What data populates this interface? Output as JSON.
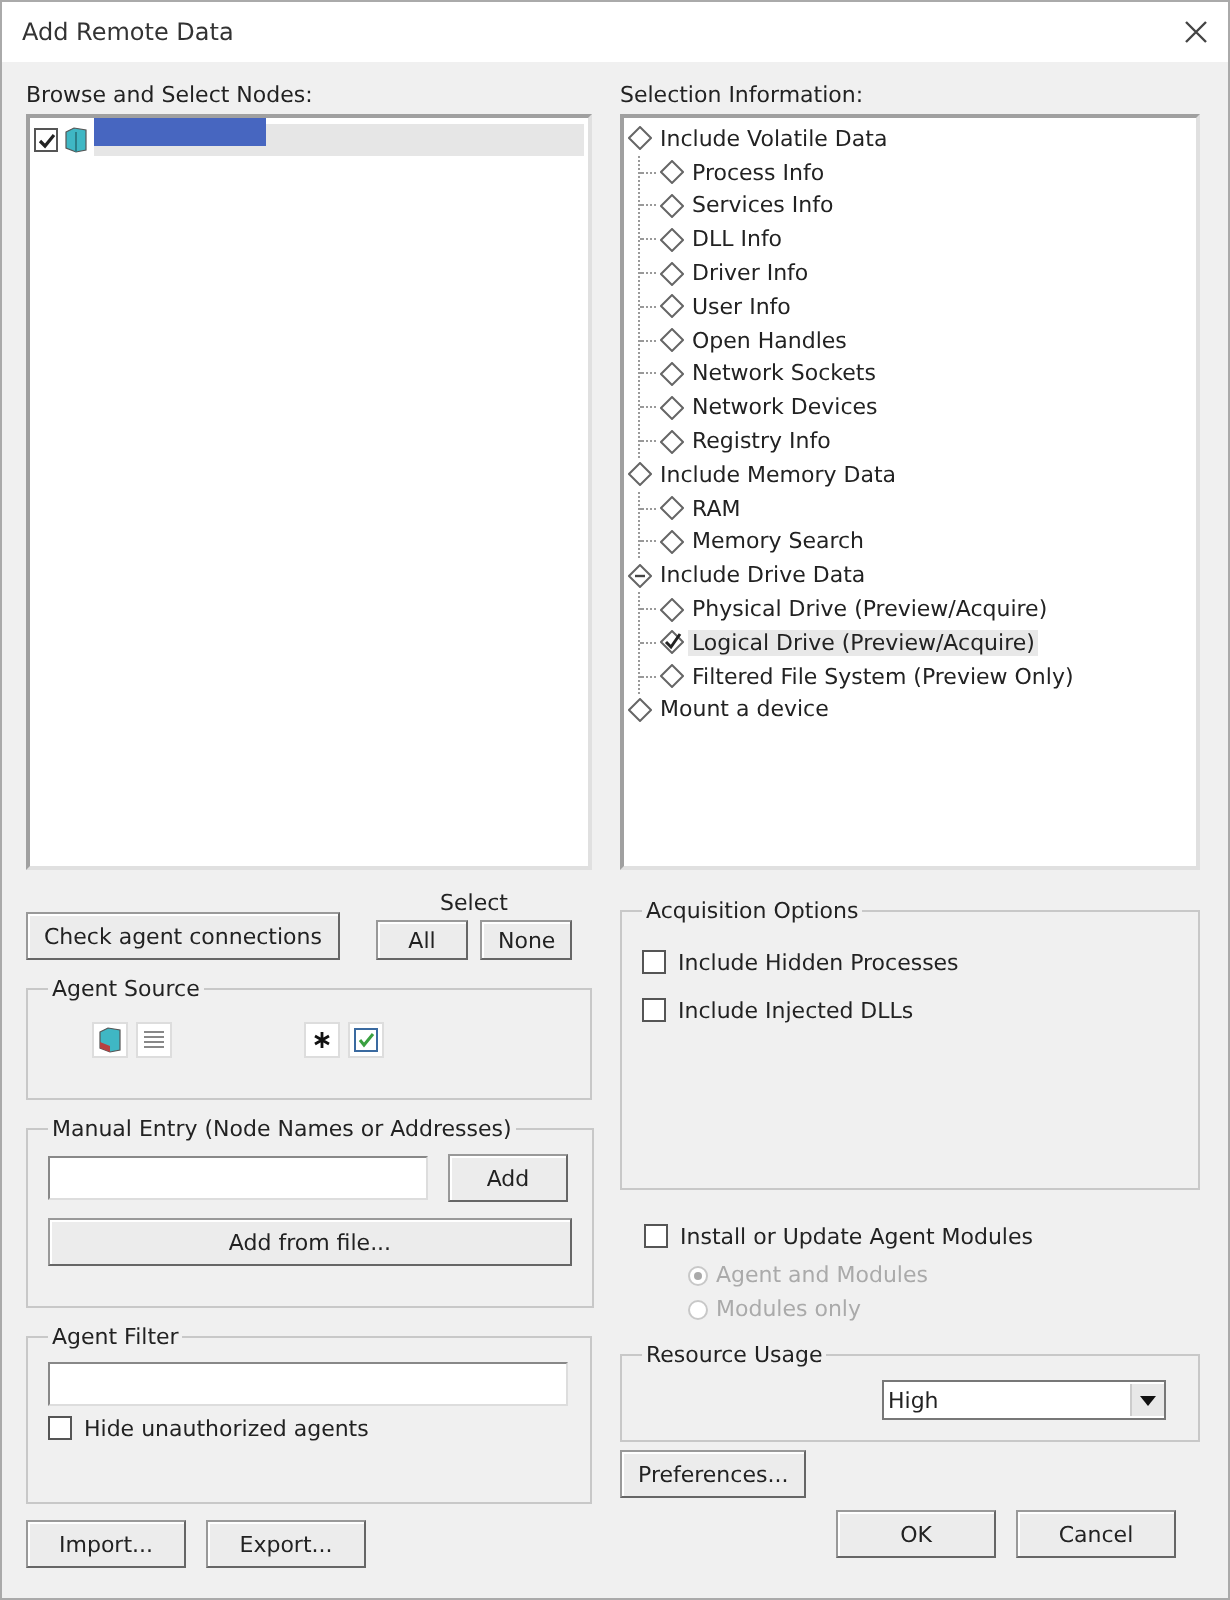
{
  "window": {
    "title": "Add Remote Data"
  },
  "nodes": {
    "label": "Browse and Select Nodes:",
    "items": [
      {
        "checked": true,
        "selected": true
      }
    ]
  },
  "selection": {
    "label": "Selection Information:",
    "tree": [
      {
        "label": "Include Volatile Data",
        "checked": false,
        "partial": false,
        "selected": false,
        "children": [
          {
            "label": "Process Info",
            "checked": false,
            "selected": false
          },
          {
            "label": "Services Info",
            "checked": false,
            "selected": false
          },
          {
            "label": "DLL Info",
            "checked": false,
            "selected": false
          },
          {
            "label": "Driver Info",
            "checked": false,
            "selected": false
          },
          {
            "label": "User Info",
            "checked": false,
            "selected": false
          },
          {
            "label": "Open Handles",
            "checked": false,
            "selected": false
          },
          {
            "label": "Network Sockets",
            "checked": false,
            "selected": false
          },
          {
            "label": "Network Devices",
            "checked": false,
            "selected": false
          },
          {
            "label": "Registry Info",
            "checked": false,
            "selected": false
          }
        ]
      },
      {
        "label": "Include Memory Data",
        "checked": false,
        "partial": false,
        "selected": false,
        "children": [
          {
            "label": "RAM",
            "checked": false,
            "selected": false
          },
          {
            "label": "Memory Search",
            "checked": false,
            "selected": false
          }
        ]
      },
      {
        "label": "Include Drive Data",
        "checked": false,
        "partial": true,
        "selected": false,
        "children": [
          {
            "label": "Physical Drive (Preview/Acquire)",
            "checked": false,
            "selected": false
          },
          {
            "label": "Logical Drive (Preview/Acquire)",
            "checked": true,
            "selected": true
          },
          {
            "label": "Filtered File System (Preview Only)",
            "checked": false,
            "selected": false
          }
        ]
      },
      {
        "label": "Mount a device",
        "checked": false,
        "partial": false,
        "selected": false
      }
    ]
  },
  "check_connections": "Check agent connections",
  "select": {
    "label": "Select",
    "buttons": [
      "All",
      "None"
    ]
  },
  "agent_source": {
    "title": "Agent Source"
  },
  "manual_entry": {
    "title": "Manual Entry (Node Names or Addresses)",
    "add": "Add",
    "add_from_file": "Add from file..."
  },
  "agent_filter": {
    "title": "Agent Filter",
    "hide_unauthorized": {
      "label": "Hide unauthorized agents",
      "checked": false
    }
  },
  "acquisition_options": {
    "title": "Acquisition Options",
    "options": [
      {
        "label": "Include Hidden Processes",
        "checked": false
      },
      {
        "label": "Include Injected DLLs",
        "checked": false
      }
    ]
  },
  "install": {
    "label": "Install or Update Agent Modules",
    "checked": false,
    "radios": [
      {
        "label": "Agent and Modules",
        "selected": true
      },
      {
        "label": "Modules only",
        "selected": false
      }
    ]
  },
  "resource_usage": {
    "title": "Resource Usage",
    "value": "High"
  },
  "preferences": "Preferences...",
  "footer": {
    "left": [
      "Import...",
      "Export..."
    ],
    "right": [
      "OK",
      "Cancel"
    ]
  }
}
